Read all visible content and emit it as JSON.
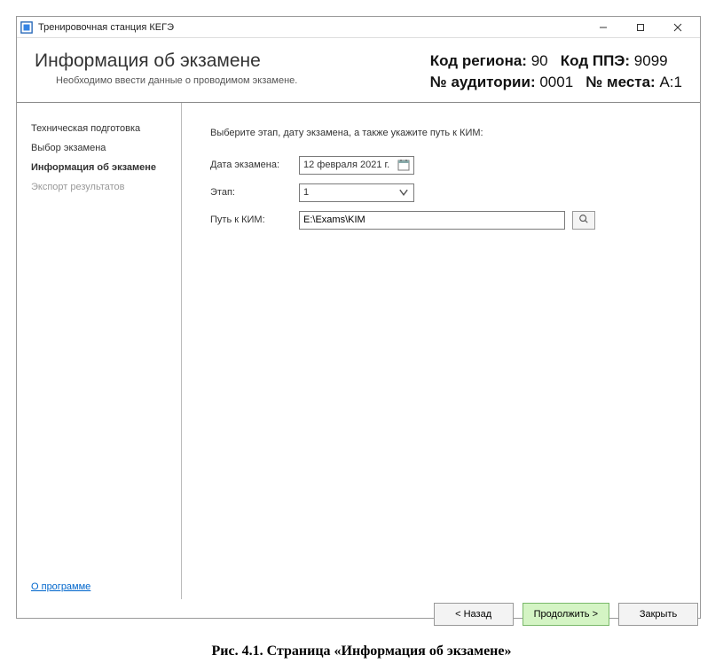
{
  "window": {
    "title": "Тренировочная станция КЕГЭ"
  },
  "header": {
    "title": "Информация об экзамене",
    "subtitle": "Необходимо ввести данные о проводимом экзамене.",
    "region_label": "Код региона:",
    "region_value": "90",
    "ppe_label": "Код ППЭ:",
    "ppe_value": "9099",
    "room_label": "№ аудитории:",
    "room_value": "0001",
    "place_label": "№ места:",
    "place_value": "A:1"
  },
  "sidebar": {
    "items": [
      {
        "label": "Техническая подготовка",
        "state": "normal"
      },
      {
        "label": "Выбор экзамена",
        "state": "normal"
      },
      {
        "label": "Информация об экзамене",
        "state": "active"
      },
      {
        "label": "Экспорт результатов",
        "state": "disabled"
      }
    ],
    "about": "О программе"
  },
  "main": {
    "instruction": "Выберите этап, дату экзамена, а также укажите путь к КИМ:",
    "date_label": "Дата экзамена:",
    "date_value": "12  февраля  2021 г.",
    "stage_label": "Этап:",
    "stage_value": "1",
    "path_label": "Путь к КИМ:",
    "path_value": "E:\\Exams\\KIM"
  },
  "footer": {
    "back": "< Назад",
    "continue": "Продолжить >",
    "close": "Закрыть"
  },
  "caption": "Рис. 4.1. Страница «Информация об экзамене»"
}
